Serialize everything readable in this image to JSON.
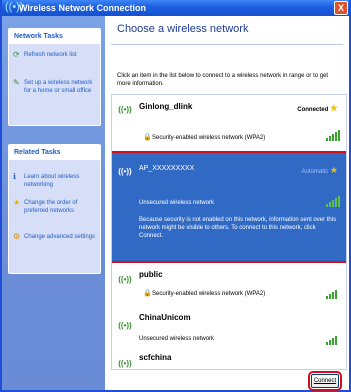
{
  "window": {
    "title": "Wireless Network Connection",
    "close_label": "X"
  },
  "sidebar": {
    "network_tasks": {
      "title": "Network Tasks",
      "items": [
        {
          "label": "Refresh network list",
          "icon": "refresh-icon"
        },
        {
          "label": "Set up a wireless network for a home or small office",
          "icon": "setup-icon"
        }
      ]
    },
    "related_tasks": {
      "title": "Related Tasks",
      "items": [
        {
          "label": "Learn about wireless networking",
          "icon": "info-icon"
        },
        {
          "label": "Change the order of preferred networks",
          "icon": "star-icon"
        },
        {
          "label": "Change advanced settings",
          "icon": "settings-icon"
        }
      ]
    }
  },
  "main": {
    "heading": "Choose a wireless network",
    "intro": "Click an item in the list below to connect to a wireless network in range or to get more information.",
    "networks": [
      {
        "name": "Ginlong_dlink",
        "status": "Connected",
        "security": "Security-enabled wireless network (WPA2)",
        "signal": 5,
        "selected": false
      },
      {
        "name": "AP_XXXXXXXXX",
        "status": "Automatic",
        "security": "Unsecured wireless network",
        "description": "Because security is not enabled on this network, information sent over this network might be visible to others. To connect to this network, click Connect.",
        "signal": 5,
        "selected": true
      },
      {
        "name": "public",
        "security": "Security-enabled wireless network (WPA2)",
        "signal": 4,
        "selected": false
      },
      {
        "name": "ChinaUnicom",
        "security": "Unsecured wireless network",
        "signal": 4,
        "selected": false
      },
      {
        "name": "scfchina",
        "signal": 3,
        "selected": false
      }
    ]
  },
  "buttons": {
    "connect": "Connect"
  },
  "colors": {
    "titlebar": "#1c5fe0",
    "sidebar": "#6d8fd9",
    "selected_row": "#316ac5",
    "highlight_outline": "#d10e1c",
    "signal_green": "#3ba332"
  }
}
